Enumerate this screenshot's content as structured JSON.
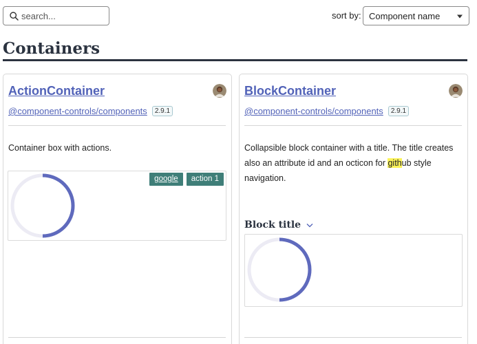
{
  "search": {
    "placeholder": "search...",
    "value": "",
    "icon": "search-icon"
  },
  "sort": {
    "label": "sort by:",
    "selected": "Component name",
    "icon": "caret-down-icon"
  },
  "page": {
    "title": "Containers"
  },
  "colors": {
    "accent_link": "#5162b8",
    "heading": "#2b3340",
    "action_button": "#3f7e78",
    "donut_fill": "#5f6abd",
    "donut_track": "#ecebf4",
    "highlight": "#fbf35a"
  },
  "cards": [
    {
      "title": "ActionContainer",
      "package": "@component-controls/components",
      "version": "2.9.1",
      "avatar": "avatar",
      "description": "Container box with actions.",
      "actions": [
        {
          "label": "google"
        },
        {
          "label": "action 1"
        }
      ],
      "donut": {
        "fraction": 0.5
      }
    },
    {
      "title": "BlockContainer",
      "package": "@component-controls/components",
      "version": "2.9.1",
      "avatar": "avatar",
      "description_before": "Collapsible block container with a title. The title creates also an attribute id and an octicon for ",
      "description_highlight": "gith",
      "description_after": "ub style navigation.",
      "block_title": "Block title",
      "chevron": "chevron-down-icon",
      "donut": {
        "fraction": 0.5
      }
    }
  ]
}
